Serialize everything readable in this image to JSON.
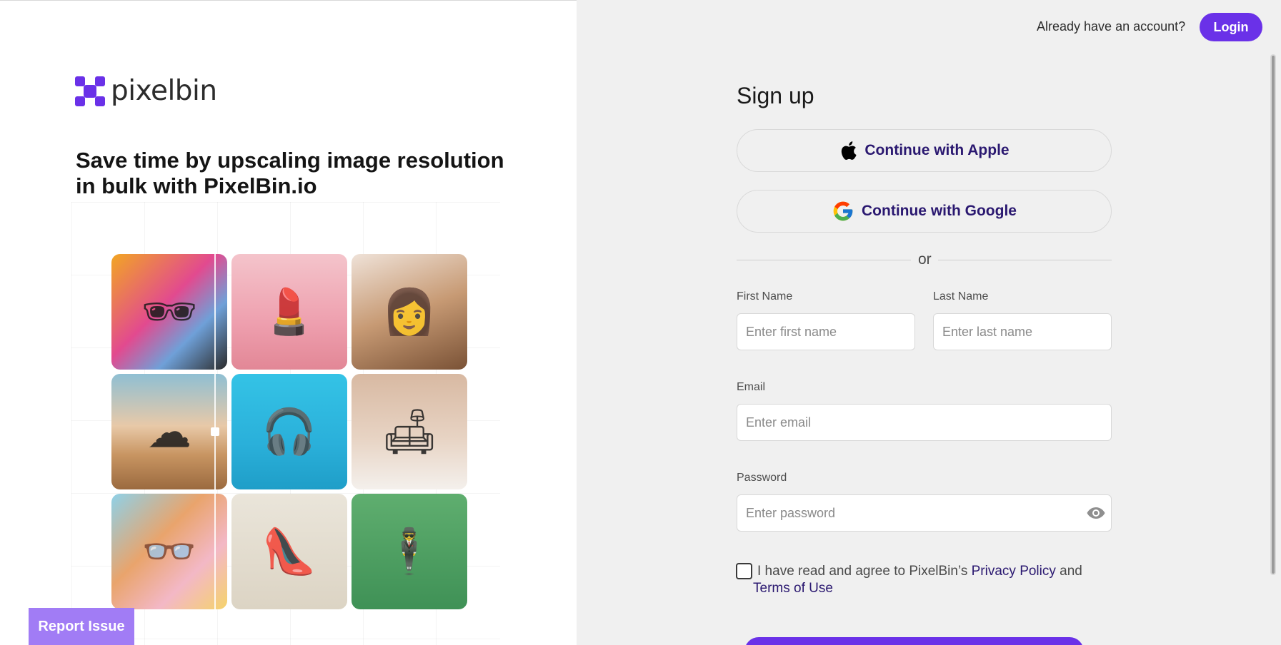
{
  "brand": {
    "name": "pixelbin",
    "color": "#6a31e8"
  },
  "headline": "Save time by upscaling image resolution in bulk with PixelBin.io",
  "gallery": [
    {
      "name": "man-sunglasses-colorful",
      "icon": "🕶"
    },
    {
      "name": "cosmetics-products",
      "icon": "💄"
    },
    {
      "name": "woman-wavy-hair",
      "icon": "👩"
    },
    {
      "name": "desert-sky",
      "icon": "☁"
    },
    {
      "name": "white-headphones",
      "icon": "🎧"
    },
    {
      "name": "white-sofa",
      "icon": "🛋"
    },
    {
      "name": "woman-curly-hair",
      "icon": "👓"
    },
    {
      "name": "blue-high-heel",
      "icon": "👠"
    },
    {
      "name": "man-white-suit",
      "icon": "🕴"
    }
  ],
  "report_issue": "Report Issue",
  "header": {
    "already_text": "Already have an account?",
    "login_label": "Login"
  },
  "signup": {
    "title": "Sign up",
    "apple_label": "Continue with Apple",
    "google_label": "Continue with Google",
    "or_text": "or",
    "first_name": {
      "label": "First Name",
      "placeholder": "Enter first name",
      "value": ""
    },
    "last_name": {
      "label": "Last Name",
      "placeholder": "Enter last name",
      "value": ""
    },
    "email": {
      "label": "Email",
      "placeholder": "Enter email",
      "value": ""
    },
    "password": {
      "label": "Password",
      "placeholder": "Enter password",
      "value": ""
    },
    "agree_prefix": "I have read and agree to PixelBin’s",
    "privacy_label": "Privacy Policy",
    "agree_and": "and",
    "terms_label": "Terms of Use",
    "terms_checked": false
  }
}
